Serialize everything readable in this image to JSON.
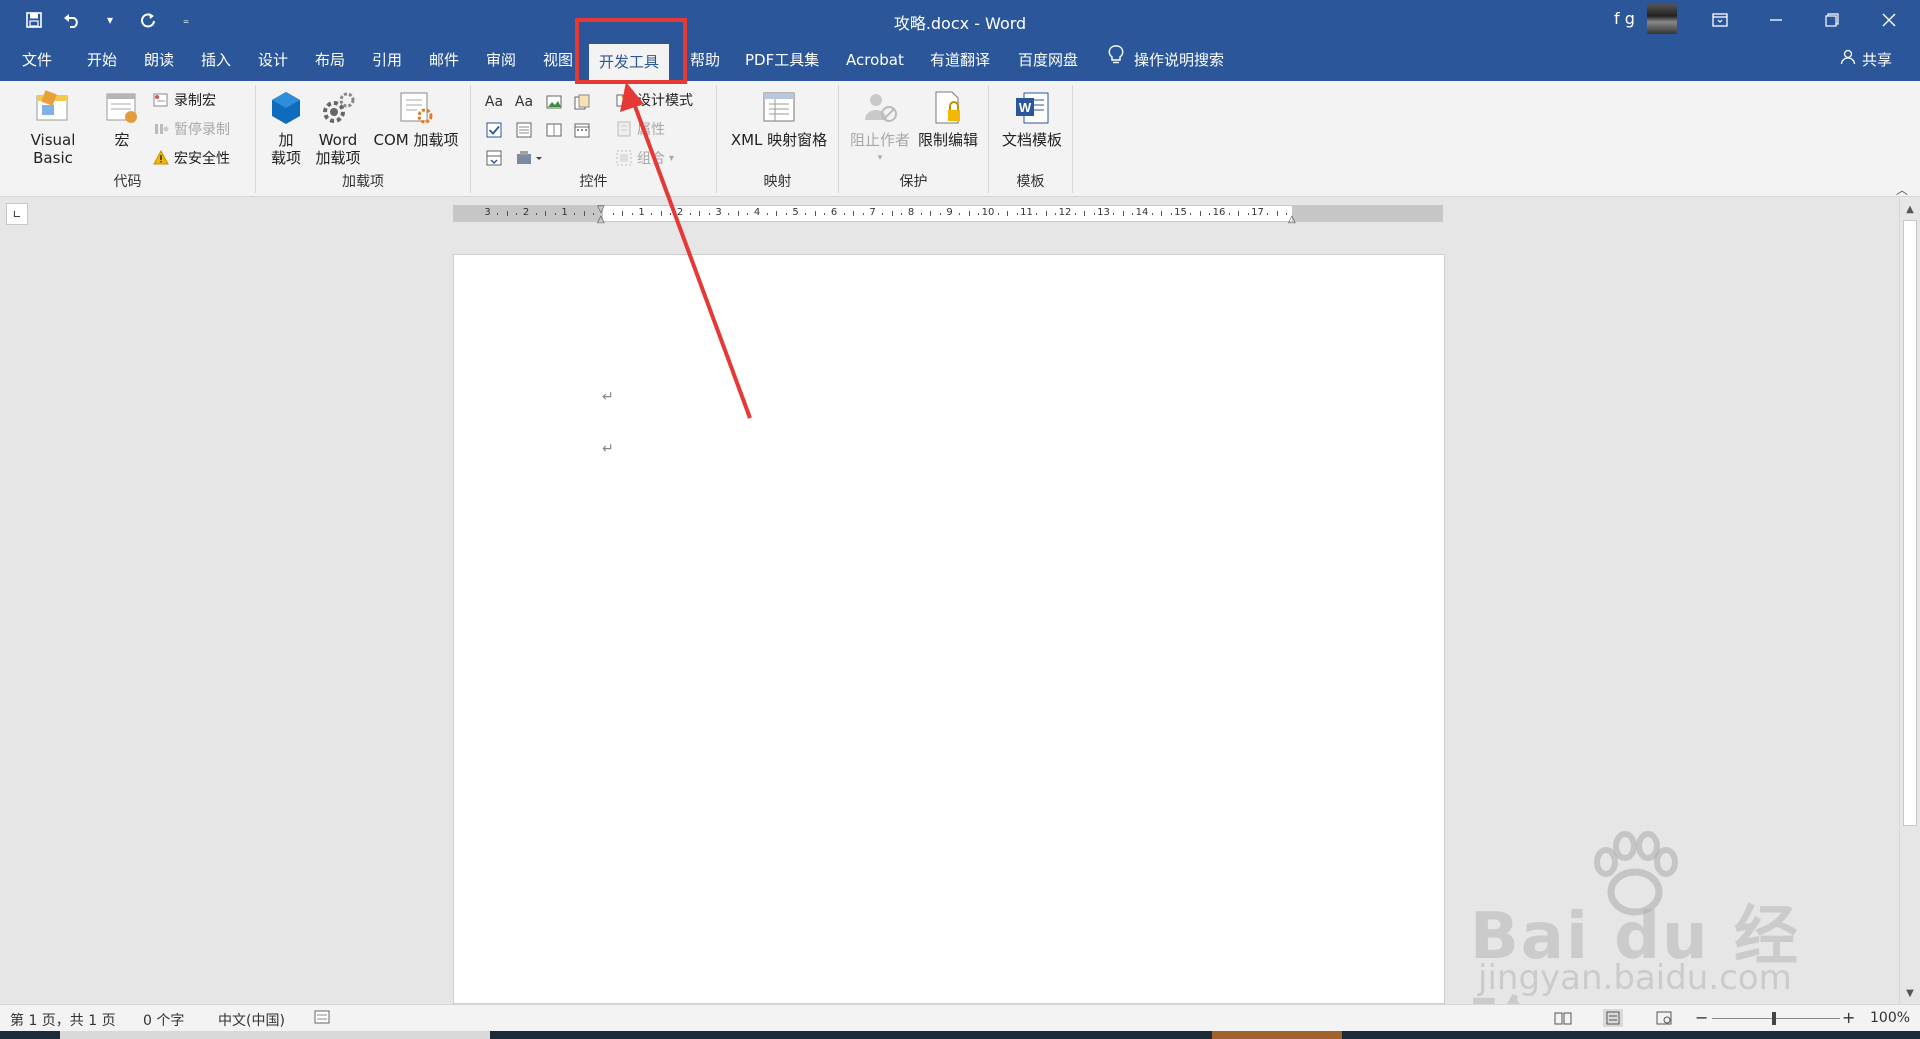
{
  "titlebar": {
    "document_title": "攻略.docx  -  Word",
    "user_name": "f g",
    "qat": {
      "save_icon": "save-icon",
      "undo_icon": "undo-icon",
      "redo_icon": "redo-icon",
      "customize_icon": "customize-qat-icon"
    },
    "window_buttons": [
      "ribbon-display-options-icon",
      "minimize-icon",
      "restore-icon",
      "close-icon"
    ]
  },
  "tabs": [
    {
      "label": "文件"
    },
    {
      "label": "开始"
    },
    {
      "label": "朗读"
    },
    {
      "label": "插入"
    },
    {
      "label": "设计"
    },
    {
      "label": "布局"
    },
    {
      "label": "引用"
    },
    {
      "label": "邮件"
    },
    {
      "label": "审阅"
    },
    {
      "label": "视图"
    },
    {
      "label": "开发工具",
      "active": true
    },
    {
      "label": "帮助"
    },
    {
      "label": "PDF工具集"
    },
    {
      "label": "Acrobat"
    },
    {
      "label": "有道翻译"
    },
    {
      "label": "百度网盘"
    }
  ],
  "tell_me": "操作说明搜索",
  "share": "共享",
  "ribbon": {
    "code": {
      "label": "代码",
      "visual_basic": "Visual Basic",
      "macros": "宏",
      "record_macro": "录制宏",
      "pause_recording": "暂停录制",
      "macro_security": "宏安全性"
    },
    "addins": {
      "label": "加载项",
      "add_ins_line1": "加",
      "add_ins_line2": "载项",
      "word_addins_line1": "Word",
      "word_addins_line2": "加载项",
      "com_addins": "COM 加载项"
    },
    "controls": {
      "label": "控件",
      "design_mode": "设计模式",
      "properties": "属性",
      "group": "组合",
      "rich_text": "Aa",
      "plain_text": "Aa"
    },
    "mapping": {
      "label": "映射",
      "xml_pane": "XML 映射窗格"
    },
    "protect": {
      "label": "保护",
      "block_authors": "阻止作者",
      "restrict_editing": "限制编辑"
    },
    "templates": {
      "label": "模板",
      "document_template": "文档模板"
    }
  },
  "ruler": {
    "numbers": [
      "3",
      "2",
      "1",
      "1",
      "2",
      "3",
      "4",
      "5",
      "6",
      "7",
      "8",
      "9",
      "10",
      "11",
      "12",
      "13",
      "14",
      "15",
      "16",
      "17"
    ]
  },
  "document": {
    "paragraph_marks": [
      "↵",
      "↵"
    ]
  },
  "statusbar": {
    "page": "第 1 页，共 1 页",
    "words": "0 个字",
    "language": "中文(中国)",
    "zoom": "100%",
    "zoom_minus": "−",
    "zoom_plus": "+"
  },
  "watermark": {
    "main": "Bai du 经验",
    "sub": "jingyan.baidu.com"
  },
  "colors": {
    "title_bar": "#2b579a",
    "ribbon_bg": "#f3f3f3",
    "highlight_red": "#e53935"
  }
}
